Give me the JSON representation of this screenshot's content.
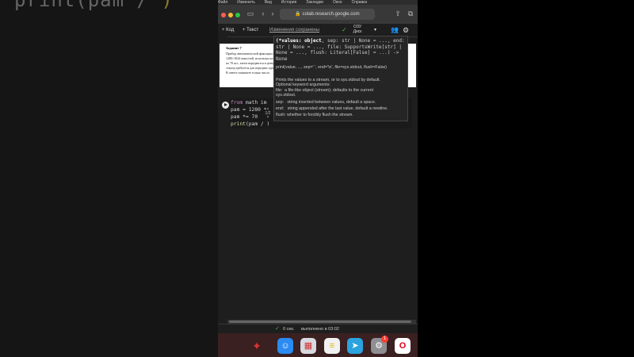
{
  "background": {
    "code_text_a": "print(",
    "code_text_b": "pam / ",
    "code_text_c": ")"
  },
  "menubar": {
    "items": [
      "Файл",
      "Изменить",
      "Вид",
      "История",
      "Закладки",
      "Окно",
      "Справка"
    ]
  },
  "browser": {
    "url": "colab.research.google.com"
  },
  "colab_toolbar": {
    "add_code_label": "+ Код",
    "add_text_label": "+ Текст",
    "save_status": "Изменения сохранены",
    "ram_label": "ОЗУ",
    "disk_label": "Диск"
  },
  "text_cell": {
    "title": "Задание 7",
    "lines": [
      "Прибор автоматической фиксации нарушений правил дорожного движения делает цветные фотографии размером",
      "1280×1024 пикселей, используя палитру из 4096 цветов. Для передачи снимки группируются в пакеты по 70 шт. …",
      "по 70 шт., затем передаются в центр обработки информации со скоростью передачи данных 1 572 864 бит/с. Сколько",
      "секунд требуется для передачи одного пакета фотографий?",
      "В ответе запишите только число."
    ]
  },
  "code_cell": {
    "line1_kw": "from",
    "line1_rest": " math im",
    "line2": "pam = 1280 *",
    "line3": "pam *= 70",
    "line4_fn": "print",
    "line4_rest": "(pam / )"
  },
  "tooltip": {
    "signature_line1_b": "(*values: object",
    "signature_line1_r": ", sep: str | None = ..., end:",
    "signature_line2": "str | None = ..., file: SupportsWrite[str] |",
    "signature_line3": "None = ..., flush: Literal[False] = ...) ->",
    "signature_line4": "None",
    "example": "print(value, ..., sep=' ', end='\\n', file=sys.stdout, flush=False)",
    "doc_lines": [
      "Prints the values to a stream, or to sys.stdout by default.",
      "Optional keyword arguments:",
      "file:  a file-like object (stream); defaults to the current",
      "sys.stdout.",
      "sep:   string inserted between values, default a space.",
      "end:   string appended after the last value, default a newline.",
      "flush: whether to forcibly flush the stream."
    ],
    "pager": "1/2"
  },
  "statusbar": {
    "time": "0 сек.",
    "completed": "выполнено в 03:02"
  },
  "dock": {
    "telegram_badge": "1"
  }
}
